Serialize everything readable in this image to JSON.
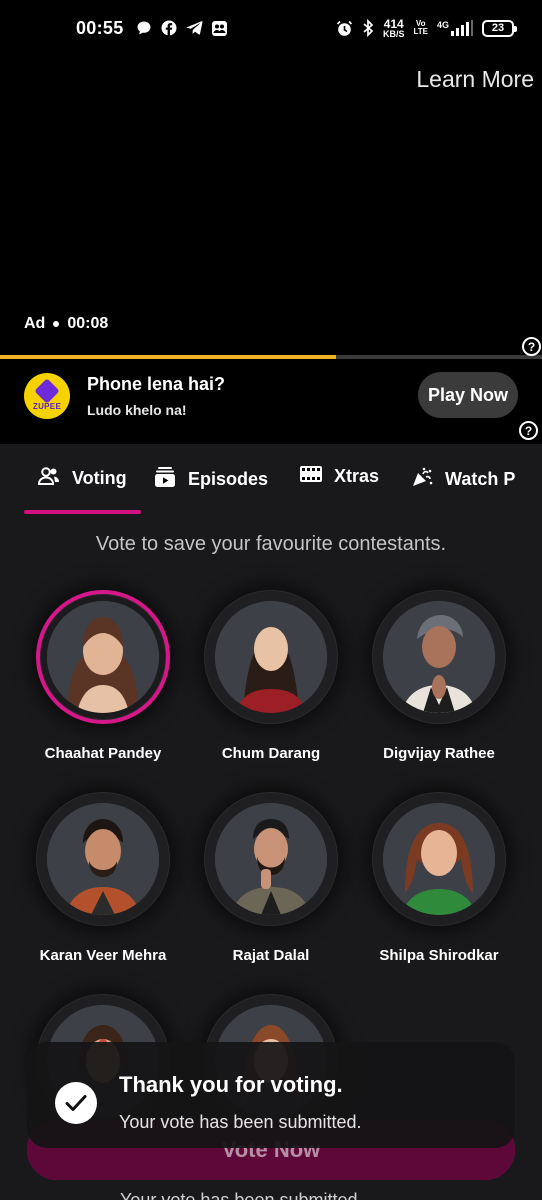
{
  "status_bar": {
    "time": "00:55",
    "speed_value": "414",
    "speed_unit": "KB/S",
    "volte_top": "Vo",
    "volte_bottom": "LTE",
    "network": "4G",
    "battery": "23",
    "left_icons": [
      "messaging-icon",
      "facebook-icon",
      "telegram-icon",
      "contacts-icon"
    ],
    "right_icons": [
      "alarm-icon",
      "bluetooth-icon",
      "signal-icon"
    ]
  },
  "ad": {
    "learn_more": "Learn More",
    "label": "Ad",
    "time": "00:08",
    "progress": 0.62,
    "progress_color": "#f0b323",
    "banner_logo_text": "ZUPEE",
    "banner_title": "Phone lena hai?",
    "banner_subtitle": "Ludo khelo na!",
    "cta": "Play Now"
  },
  "tabs": [
    {
      "label": "Voting",
      "icon": "people-icon",
      "active": true
    },
    {
      "label": "Episodes",
      "icon": "episodes-icon",
      "active": false
    },
    {
      "label": "Xtras",
      "icon": "film-icon",
      "active": false
    },
    {
      "label": "Watch P",
      "icon": "party-icon",
      "active": false
    }
  ],
  "subtitle": "Vote to save your favourite contestants.",
  "contestants": [
    {
      "name": "Chaahat Pandey",
      "selected": true
    },
    {
      "name": "Chum Darang",
      "selected": false
    },
    {
      "name": "Digvijay Rathee",
      "selected": false
    },
    {
      "name": "Karan Veer Mehra",
      "selected": false
    },
    {
      "name": "Rajat Dalal",
      "selected": false
    },
    {
      "name": "Shilpa Shirodkar",
      "selected": false
    },
    {
      "name": "",
      "selected": false
    },
    {
      "name": "",
      "selected": false
    }
  ],
  "toast": {
    "title": "Thank you for voting.",
    "message": "Your vote has been submitted."
  },
  "vote_button": "Vote Now",
  "ghost_text": "Your vote has been submitted.",
  "colors": {
    "accent": "#d1117f",
    "background": "#19191b",
    "ad_progress": "#f0b323"
  }
}
